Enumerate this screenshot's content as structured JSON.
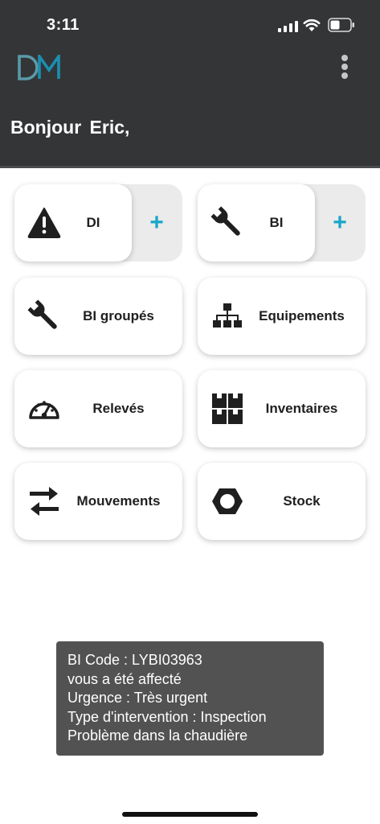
{
  "status_bar": {
    "time": "3:11"
  },
  "header": {
    "logo_text": "DM",
    "greeting": "Bonjour  Eric,"
  },
  "tiles": {
    "di": {
      "label": "DI",
      "add": "+"
    },
    "bi": {
      "label": "BI",
      "add": "+"
    },
    "bi_groupes": {
      "label": "BI groupés"
    },
    "equipements": {
      "label": "Equipements"
    },
    "releves": {
      "label": "Relevés"
    },
    "inventaires": {
      "label": "Inventaires"
    },
    "mouvements": {
      "label": "Mouvements"
    },
    "stock": {
      "label": "Stock"
    }
  },
  "toast": {
    "lines": [
      "BI Code : LYBI03963",
      "vous a été affecté",
      "Urgence : Très urgent",
      "Type d'intervention : Inspection",
      "Problème dans la chaudière"
    ]
  },
  "colors": {
    "header_bg": "#343537",
    "accent": "#17a7c9",
    "toast_bg": "#525252"
  }
}
